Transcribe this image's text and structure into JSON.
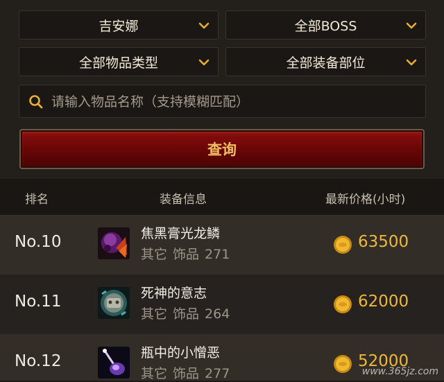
{
  "filters": {
    "server": "吉安娜",
    "boss": "全部BOSS",
    "item_type": "全部物品类型",
    "slot": "全部装备部位"
  },
  "search": {
    "placeholder": "请输入物品名称（支持模糊匹配）",
    "value": ""
  },
  "query_button": "查询",
  "table": {
    "headers": {
      "rank": "排名",
      "info": "装备信息",
      "price": "最新价格(小时)"
    },
    "rows": [
      {
        "rank": "No.10",
        "name": "焦黑膏光龙鳞",
        "category": "其它",
        "subtype": "饰品",
        "level": "271",
        "price": "63500",
        "icon": "charred-dragon-scale-icon"
      },
      {
        "rank": "No.11",
        "name": "死神的意志",
        "category": "其它",
        "subtype": "饰品",
        "level": "264",
        "price": "62000",
        "icon": "will-of-death-icon"
      },
      {
        "rank": "No.12",
        "name": "瓶中的小憎恶",
        "category": "其它",
        "subtype": "饰品",
        "level": "277",
        "price": "52000",
        "icon": "abomination-in-bottle-icon"
      }
    ]
  },
  "watermark": "www.365jz.com",
  "colors": {
    "accent_gold": "#f0b83a",
    "button_red": "#7a0a0a",
    "chevron_gold": "#e8b030"
  }
}
